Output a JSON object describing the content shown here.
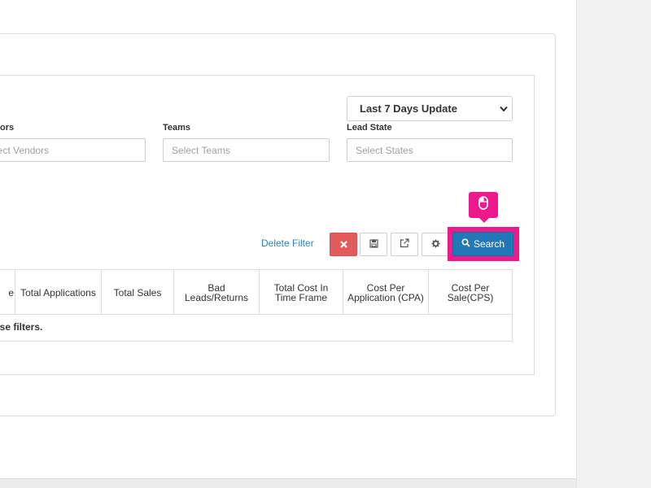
{
  "filters": {
    "date_range": "Last 7 Days Update",
    "vendors_label": "ors",
    "vendors_placeholder": "lect Vendors",
    "teams_label": "Teams",
    "teams_placeholder": "Select Teams",
    "lead_state_label": "Lead State",
    "lead_state_placeholder": "Select States"
  },
  "actions": {
    "delete_filter": "Delete Filter",
    "search": "Search",
    "icons": [
      "close-icon",
      "save-icon",
      "external-link-icon",
      "gear-icon",
      "search-icon",
      "mouse-icon"
    ]
  },
  "table": {
    "columns": [
      "e",
      "Total Applications",
      "Total Sales",
      "Bad Leads/Returns",
      "Total Cost In Time Frame",
      "Cost Per Application (CPA)",
      "Cost Per Sale(CPS)"
    ],
    "empty_message": "those filters."
  },
  "colors": {
    "primary": "#2278b5",
    "danger": "#e05b5b",
    "highlight": "#ee1a8d",
    "link": "#2a84c0"
  }
}
